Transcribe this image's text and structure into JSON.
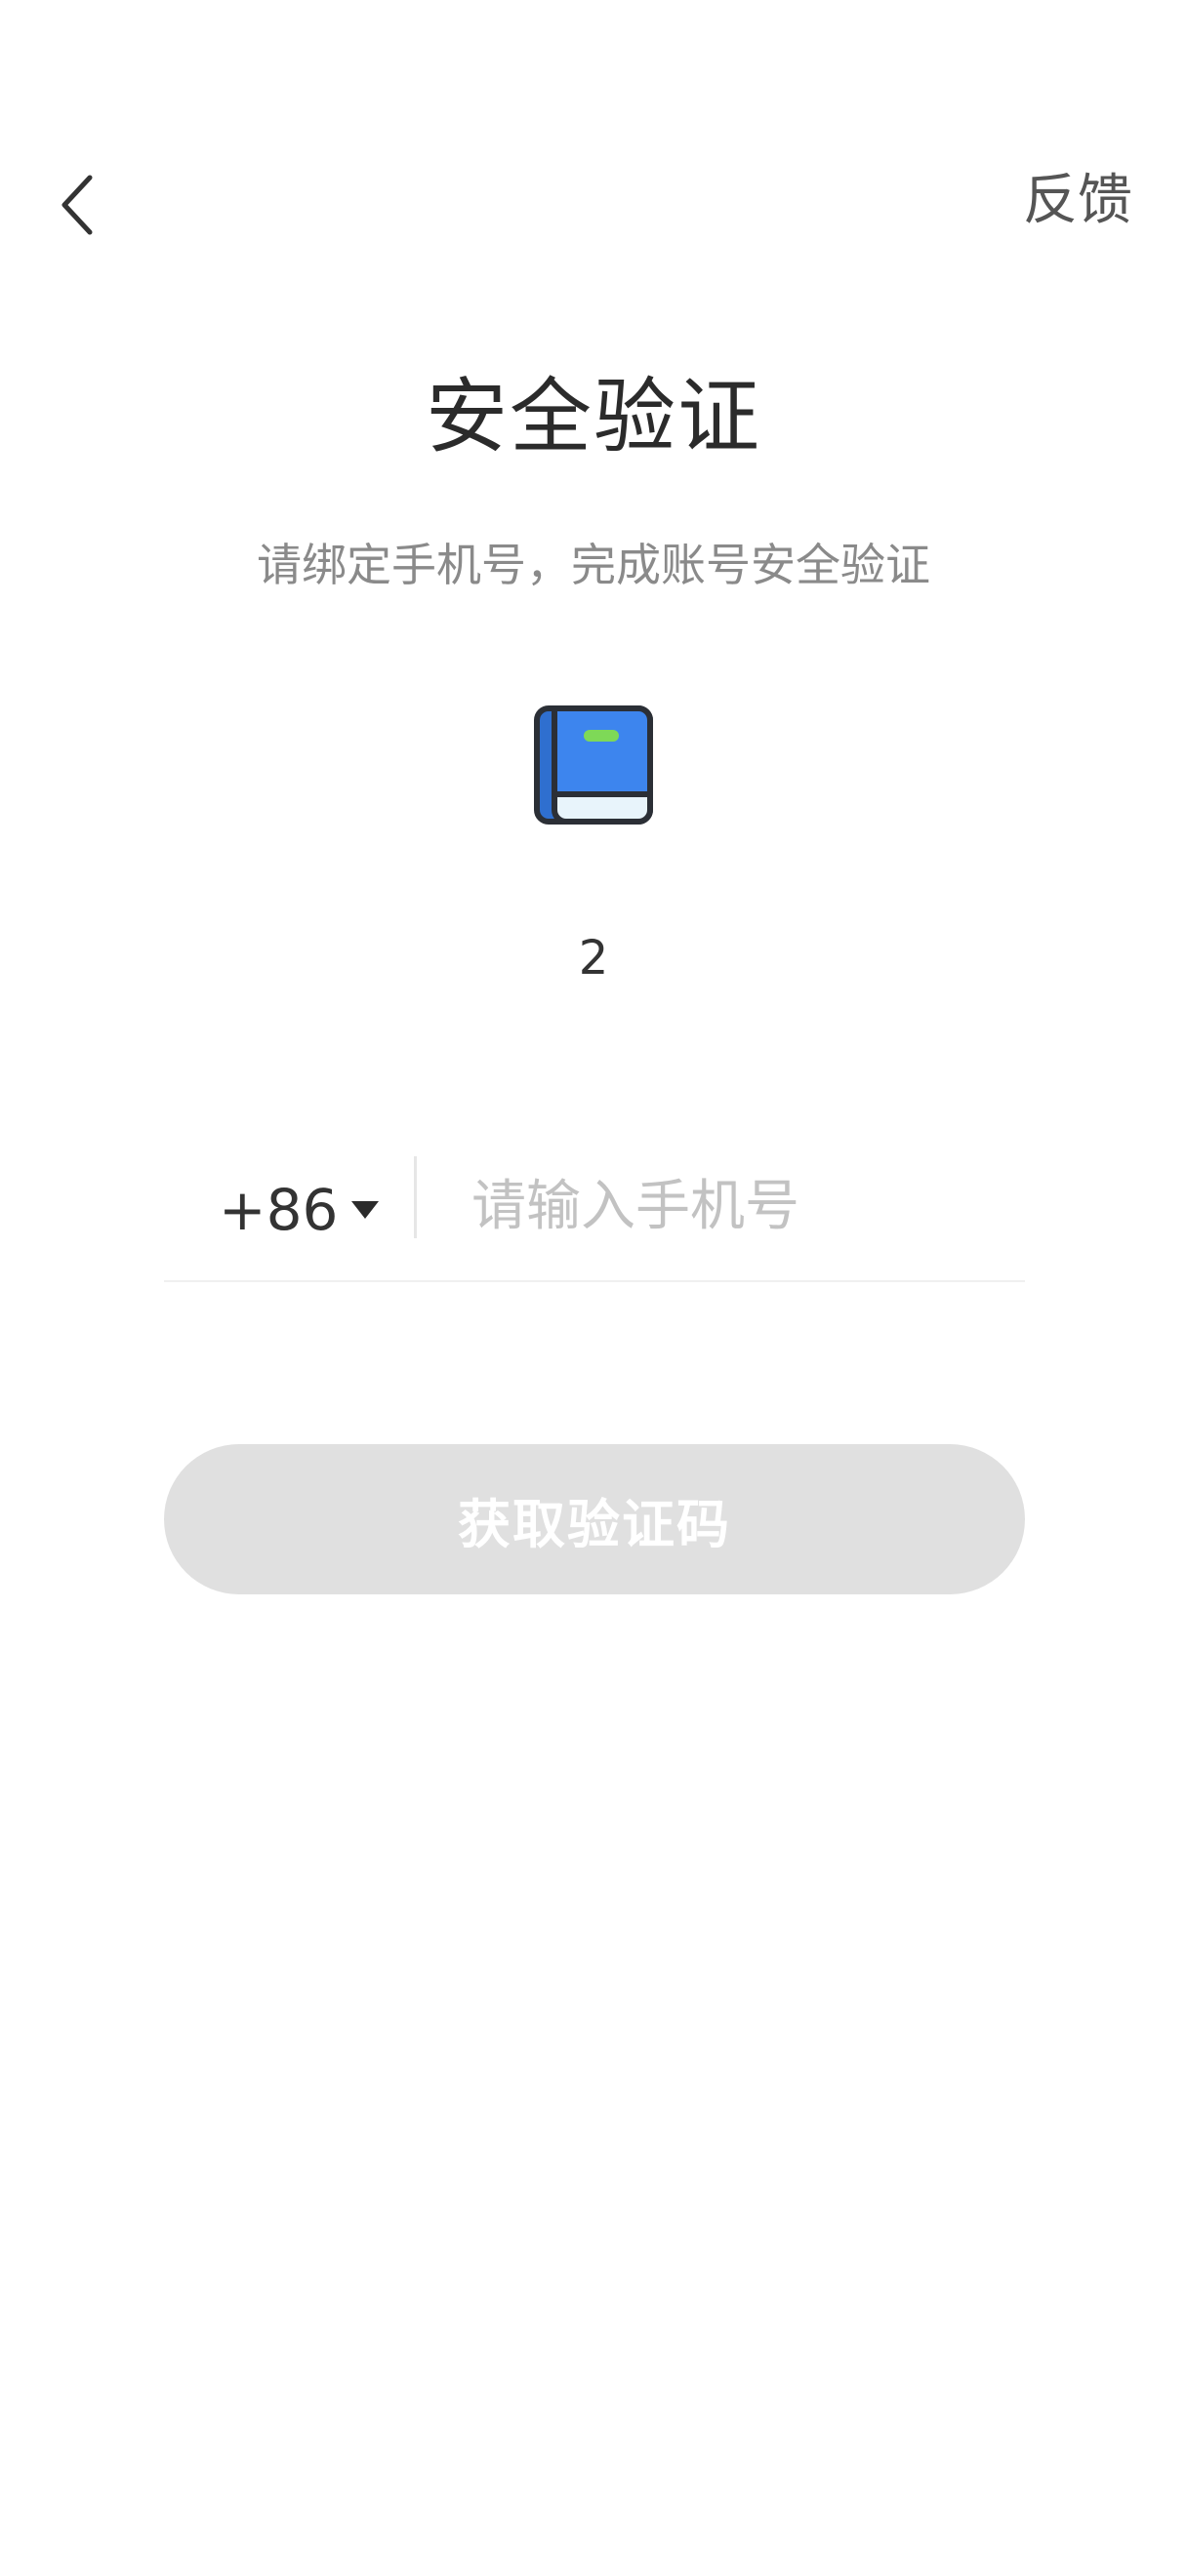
{
  "header": {
    "back_icon": "chevron-left-icon",
    "feedback_label": "反馈"
  },
  "main": {
    "title": "安全验证",
    "subtitle": "请绑定手机号，完成账号安全验证",
    "app_icon": "book-icon",
    "account_name": "2"
  },
  "phone": {
    "country_code": "+86",
    "dropdown_icon": "caret-down-icon",
    "placeholder": "请输入手机号",
    "value": ""
  },
  "actions": {
    "get_code_label": "获取验证码"
  },
  "colors": {
    "button_disabled_bg": "#e0e0e0",
    "title_text": "#2b2b2b",
    "subtitle_text": "#8a8a8a",
    "placeholder_text": "#c2c2c2",
    "book_blue": "#3d85ee",
    "book_bookmark": "#7ed957"
  }
}
